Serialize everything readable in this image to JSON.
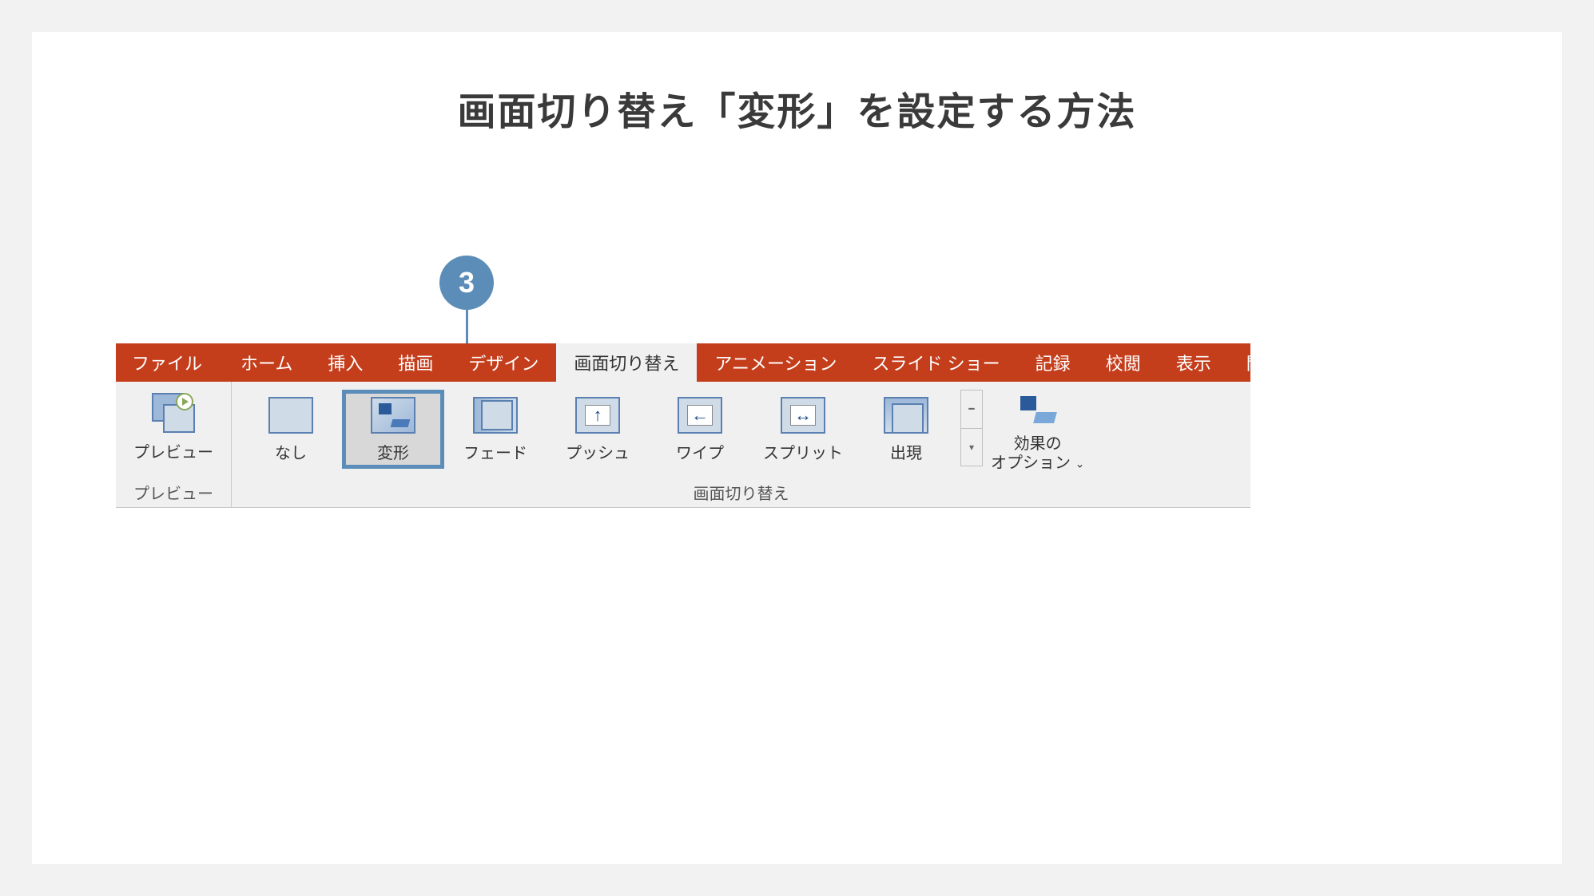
{
  "slide": {
    "title": "画面切り替え「変形」を設定する方法"
  },
  "callout": {
    "number": "3"
  },
  "tabs": {
    "file": "ファイル",
    "home": "ホーム",
    "insert": "挿入",
    "draw": "描画",
    "design": "デザイン",
    "transitions": "画面切り替え",
    "animations": "アニメーション",
    "slideshow": "スライド ショー",
    "record": "記録",
    "review": "校閲",
    "view": "表示",
    "developer": "開発"
  },
  "ribbon": {
    "preview_group": {
      "button": "プレビュー",
      "label": "プレビュー"
    },
    "transitions_group": {
      "label": "画面切り替え",
      "items": {
        "none": "なし",
        "morph": "変形",
        "fade": "フェード",
        "push": "プッシュ",
        "wipe": "ワイプ",
        "split": "スプリット",
        "appear": "出現"
      },
      "effect_options": "効果の\nオプション",
      "chevron": "⌄"
    }
  },
  "icons": {
    "push_arrow": "↑",
    "wipe_arrow": "←",
    "split_arrow": "↔",
    "more_line": "━",
    "more_down": "▾"
  }
}
